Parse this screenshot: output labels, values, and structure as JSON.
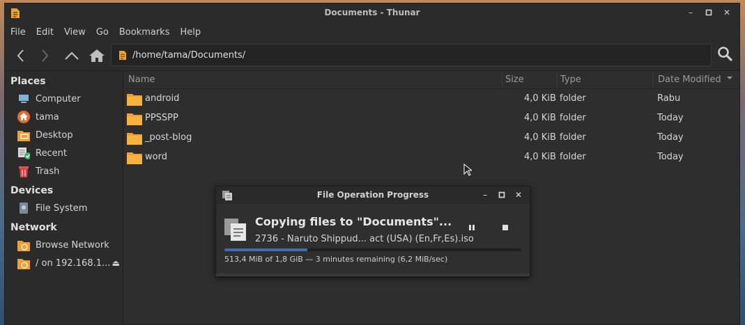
{
  "window": {
    "title": "Documents - Thunar",
    "controls": [
      "minimize-icon",
      "maximize-icon",
      "close-icon"
    ]
  },
  "menu": [
    "File",
    "Edit",
    "View",
    "Go",
    "Bookmarks",
    "Help"
  ],
  "toolbar": {
    "location": "/home/tama/Documents/"
  },
  "sidebar": {
    "places_label": "Places",
    "places": [
      "Computer",
      "tama",
      "Desktop",
      "Recent",
      "Trash"
    ],
    "devices_label": "Devices",
    "devices": [
      "File System"
    ],
    "network_label": "Network",
    "network": [
      "Browse Network",
      "/ on 192.168.1..."
    ]
  },
  "columns": {
    "name": "Name",
    "size": "Size",
    "type": "Type",
    "date": "Date Modified"
  },
  "files": [
    {
      "name": "android",
      "size": "4,0 KiB",
      "type": "folder",
      "date": "Rabu"
    },
    {
      "name": "PPSSPP",
      "size": "4,0 KiB",
      "type": "folder",
      "date": "Today"
    },
    {
      "name": "_post-blog",
      "size": "4,0 KiB",
      "type": "folder",
      "date": "Today"
    },
    {
      "name": "word",
      "size": "4,0 KiB",
      "type": "folder",
      "date": "Today"
    }
  ],
  "dialog": {
    "title": "File Operation Progress",
    "heading": "Copying files to \"Documents\"...",
    "filename": "2736 - Naruto Shippud... act (USA) (En,Fr,Es).iso",
    "status": "513,4 MiB of 1,8 GiB — 3 minutes remaining (6,2 MiB/sec)",
    "progress": 0.28
  },
  "colors": {
    "accent": "#3d6fb0",
    "folder": "#f0a030",
    "home": "#e8692c"
  }
}
